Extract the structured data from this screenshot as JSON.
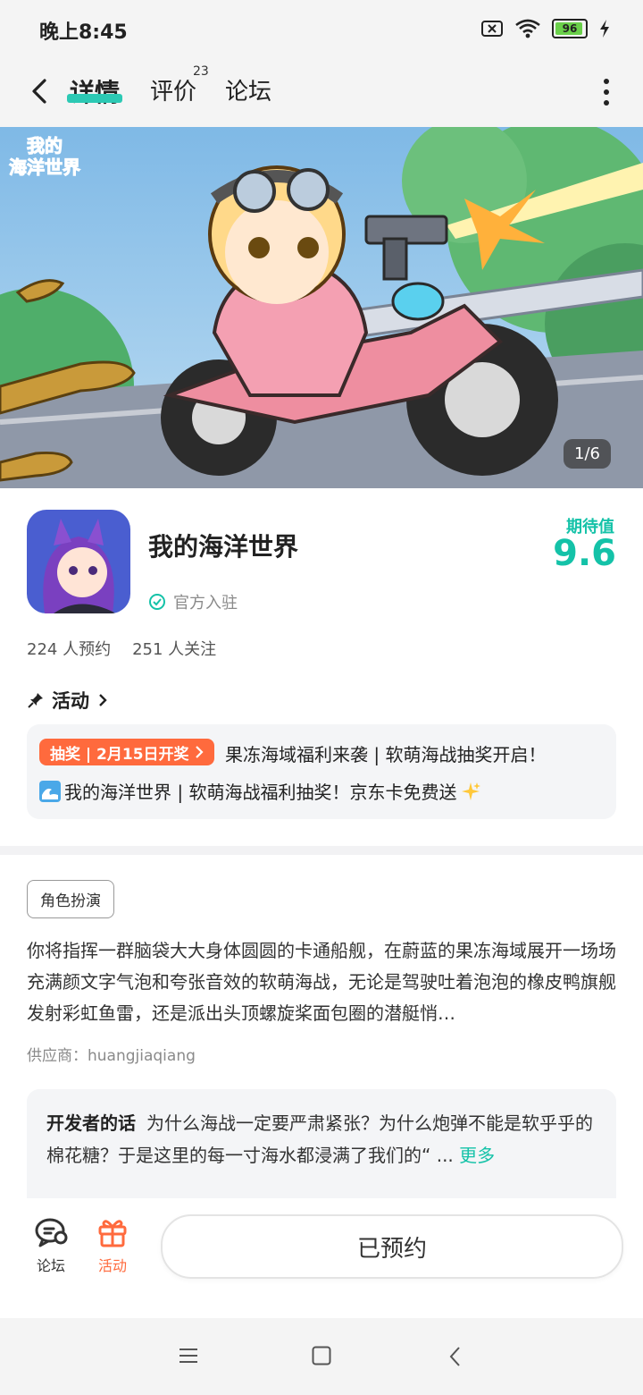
{
  "status_bar": {
    "time": "晚上8:45",
    "battery": "96"
  },
  "header": {
    "tabs": [
      {
        "label": "详情",
        "active": true
      },
      {
        "label": "评价",
        "badge": "23"
      },
      {
        "label": "论坛"
      }
    ]
  },
  "banner": {
    "logo_text_1": "我的",
    "logo_text_2": "海洋世界",
    "page_indicator": "1/6"
  },
  "app": {
    "name": "我的海洋世界",
    "official_label": "官方入驻",
    "expect_label": "期待值",
    "expect_value": "9.6",
    "reservations": "224 人预约",
    "followers": "251 人关注"
  },
  "activity": {
    "section_title": "活动",
    "tag": "抽奖 | 2月15日开奖",
    "line1": "果冻海域福利来袭 | 软萌海战抽奖开启！",
    "line2": "我的海洋世界 | 软萌海战福利抽奖！京东卡免费送"
  },
  "details": {
    "genre": "角色扮演",
    "description": "你将指挥一群脑袋大大身体圆圆的卡通船舰，在蔚蓝的果冻海域展开一场场充满颜文字气泡和夸张音效的软萌海战，无论是驾驶吐着泡泡的橡皮鸭旗舰发射彩虹鱼雷，还是派出头顶螺旋桨面包圈的潜艇悄…",
    "supplier": "供应商：huangjiaqiang",
    "developer_label": "开发者的话",
    "developer_text": "为什么海战一定要严肃紧张？为什么炮弹不能是软乎乎的棉花糖？于是这里的每一寸海水都浸满了我们的“ ...",
    "developer_more": "更多"
  },
  "action_bar": {
    "forum_label": "论坛",
    "activity_label": "活动",
    "reserve_button": "已预约"
  },
  "colors": {
    "accent": "#14c2a8",
    "orange": "#ff6a3d"
  }
}
